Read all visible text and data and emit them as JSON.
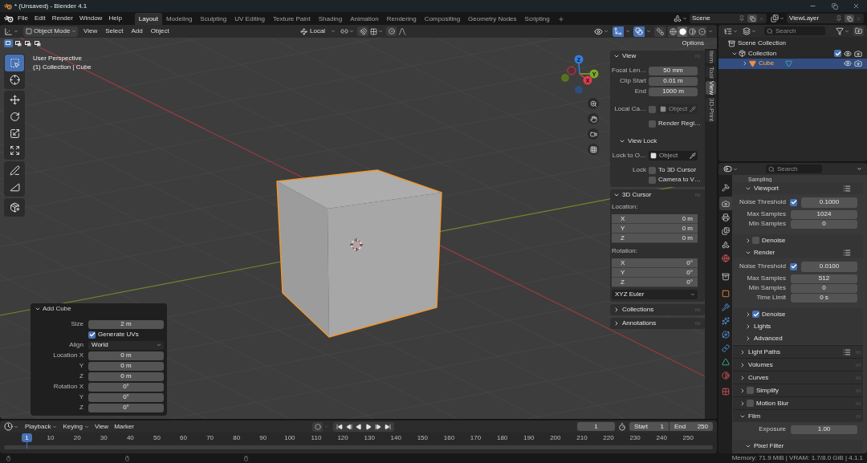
{
  "window": {
    "title": "* (Unsaved) - Blender 4.1"
  },
  "top_bar": {
    "menus": [
      "File",
      "Edit",
      "Render",
      "Window",
      "Help"
    ],
    "workspaces": [
      {
        "label": "Layout",
        "selected": true
      },
      {
        "label": "Modeling",
        "selected": false
      },
      {
        "label": "Sculpting",
        "selected": false
      },
      {
        "label": "UV Editing",
        "selected": false
      },
      {
        "label": "Texture Paint",
        "selected": false
      },
      {
        "label": "Shading",
        "selected": false
      },
      {
        "label": "Animation",
        "selected": false
      },
      {
        "label": "Rendering",
        "selected": false
      },
      {
        "label": "Compositing",
        "selected": false
      },
      {
        "label": "Geometry Nodes",
        "selected": false
      },
      {
        "label": "Scripting",
        "selected": false
      }
    ],
    "scene": "Scene",
    "view_layer": "ViewLayer"
  },
  "viewport": {
    "header": {
      "mode": "Object Mode",
      "menus": [
        "View",
        "Select",
        "Add",
        "Object"
      ],
      "orientation": "Local",
      "snap": false,
      "proportional_editing": false,
      "gizmos": true,
      "overlays": true,
      "xray": false,
      "shading": [
        {
          "selected": false
        },
        {
          "selected": true
        },
        {
          "selected": false
        },
        {
          "selected": false
        }
      ]
    },
    "select_modes": [
      {
        "selected": true
      },
      {
        "selected": false
      },
      {
        "selected": false
      },
      {
        "selected": false
      }
    ],
    "options": "Options",
    "tool_groups": [
      [
        {
          "selected": true
        },
        {
          "selected": false
        }
      ],
      [
        {
          "selected": false
        },
        {
          "selected": false
        },
        {
          "selected": false
        },
        {
          "selected": false
        }
      ],
      [
        {
          "selected": false
        },
        {
          "selected": false
        }
      ],
      [
        {
          "selected": false
        }
      ]
    ],
    "info": [
      "User Perspective",
      "(1) Collection | Cube"
    ],
    "gizmo": {
      "x": "X",
      "y": "Y",
      "z": "Z"
    },
    "add_cube": {
      "title": "Add Cube",
      "expanded": true,
      "rows": [
        {
          "kind": "number",
          "label": "Size",
          "value": "2 m"
        },
        {
          "kind": "checkbox",
          "text": "Generate UVs",
          "checked": true
        },
        {
          "kind": "dropdown",
          "label": "Align",
          "value": "World"
        },
        {
          "kind": "number",
          "label": "Location X",
          "value": "0 m"
        },
        {
          "kind": "number",
          "label": "Y",
          "value": "0 m"
        },
        {
          "kind": "number",
          "label": "Z",
          "value": "0 m"
        },
        {
          "kind": "number",
          "label": "Rotation X",
          "value": "0°"
        },
        {
          "kind": "number",
          "label": "Y",
          "value": "0°"
        },
        {
          "kind": "number",
          "label": "Z",
          "value": "0°"
        }
      ]
    },
    "sidebar": {
      "tabs": [
        {
          "label": "Item",
          "selected": false
        },
        {
          "label": "Tool",
          "selected": false
        },
        {
          "label": "View",
          "selected": true
        },
        {
          "label": "3D-Print",
          "selected": false
        }
      ],
      "panels": [
        {
          "title": "View",
          "expanded": true,
          "rows": [
            {
              "kind": "number",
              "label": "Focal Len…",
              "value": "50 mm"
            },
            {
              "kind": "number",
              "label": "Clip Start",
              "value": "0.01 m"
            },
            {
              "kind": "number",
              "label": "End",
              "value": "1000 m"
            },
            {
              "kind": "object",
              "label": "Local Ca…",
              "checked": false,
              "placeholder": "Object",
              "disabled": true
            },
            {
              "kind": "checkbox",
              "text": "Render Regi…",
              "checked": false
            },
            {
              "kind": "subpanel",
              "label": "View Lock",
              "expanded": true
            },
            {
              "kind": "object",
              "label": "Lock to O…",
              "placeholder": "Object",
              "disabled": false
            },
            {
              "kind": "checkbox",
              "label": "Lock",
              "text": "To 3D Cursor",
              "checked": false
            },
            {
              "kind": "checkbox",
              "text": "Camera to V…",
              "checked": false
            }
          ]
        },
        {
          "title": "3D Cursor",
          "expanded": true,
          "rows": [
            {
              "kind": "caption",
              "label": "Location:"
            },
            {
              "kind": "vector",
              "label": "X",
              "value": "0 m"
            },
            {
              "kind": "vector",
              "label": "Y",
              "value": "0 m"
            },
            {
              "kind": "vector",
              "label": "Z",
              "value": "0 m"
            },
            {
              "kind": "caption",
              "label": "Rotation:"
            },
            {
              "kind": "vector",
              "label": "X",
              "value": "0°"
            },
            {
              "kind": "vector",
              "label": "Y",
              "value": "0°"
            },
            {
              "kind": "vector",
              "label": "Z",
              "value": "0°"
            },
            {
              "kind": "dropdown",
              "value": "XYZ Euler"
            }
          ]
        },
        {
          "title": "Collections",
          "expanded": false
        },
        {
          "title": "Annotations",
          "expanded": false
        }
      ]
    }
  },
  "outliner": {
    "search": {
      "placeholder": "Search"
    },
    "tree": [
      {
        "label": "Scene Collection",
        "kind": "scene_collection",
        "selected": false,
        "children": [
          {
            "label": "Collection",
            "kind": "collection",
            "expanded": true,
            "selected": false,
            "checked": true,
            "children": [
              {
                "label": "Cube",
                "kind": "mesh_object",
                "expanded": false,
                "selected": true
              }
            ]
          }
        ]
      }
    ]
  },
  "properties": {
    "search": {
      "placeholder": "Search"
    },
    "tabs": [
      {
        "selected": false
      },
      {
        "selected": true
      },
      {
        "selected": false
      },
      {
        "selected": false
      },
      {
        "selected": false
      },
      {
        "selected": false
      },
      {
        "selected": false
      },
      {
        "selected": false
      },
      {
        "selected": false
      },
      {
        "selected": false
      },
      {
        "selected": false
      },
      {
        "selected": false
      },
      {
        "selected": false
      },
      {
        "selected": false
      },
      {
        "selected": false
      }
    ],
    "scrolled_header": "Sampling",
    "rows": [
      {
        "kind": "subpanel",
        "label": "Viewport",
        "expanded": true,
        "presets": true
      },
      {
        "kind": "toggle_number",
        "label": "Noise Threshold",
        "checked": true,
        "value": "0.1000"
      },
      {
        "kind": "number",
        "label": "Max Samples",
        "value": "1024"
      },
      {
        "kind": "number",
        "label": "Min Samples",
        "value": "0"
      },
      {
        "kind": "subpanel",
        "label": "Denoise",
        "expanded": false,
        "checked": false
      },
      {
        "kind": "subpanel",
        "label": "Render",
        "expanded": true,
        "presets": true
      },
      {
        "kind": "toggle_number",
        "label": "Noise Threshold",
        "checked": true,
        "value": "0.0100"
      },
      {
        "kind": "number",
        "label": "Max Samples",
        "value": "512"
      },
      {
        "kind": "number",
        "label": "Min Samples",
        "value": "0"
      },
      {
        "kind": "number",
        "label": "Time Limit",
        "value": "0 s"
      },
      {
        "kind": "subpanel",
        "label": "Denoise",
        "expanded": false,
        "checked": true
      },
      {
        "kind": "subpanel",
        "label": "Lights",
        "expanded": false
      },
      {
        "kind": "subpanel",
        "label": "Advanced",
        "expanded": false
      },
      {
        "kind": "panel",
        "label": "Light Paths",
        "expanded": false,
        "presets": true
      },
      {
        "kind": "panel",
        "label": "Volumes",
        "expanded": false
      },
      {
        "kind": "panel",
        "label": "Curves",
        "expanded": false
      },
      {
        "kind": "panel",
        "label": "Simplify",
        "expanded": false,
        "checked": false
      },
      {
        "kind": "panel",
        "label": "Motion Blur",
        "expanded": false,
        "checked": false
      },
      {
        "kind": "panel",
        "label": "Film",
        "expanded": true
      },
      {
        "kind": "number",
        "label": "Exposure",
        "value": "1.00"
      },
      {
        "kind": "subpanel",
        "label": "Pixel Filter",
        "expanded": true
      }
    ]
  },
  "timeline": {
    "menus": [
      {
        "label": "Playback",
        "kind": "dropdown"
      },
      {
        "label": "Keying",
        "kind": "dropdown"
      },
      {
        "label": "View",
        "kind": "menu"
      },
      {
        "label": "Marker",
        "kind": "menu"
      }
    ],
    "auto_keying": false,
    "current_frame": "1",
    "start": {
      "label": "Start",
      "value": "1"
    },
    "end": {
      "label": "End",
      "value": "250"
    },
    "playhead": "1",
    "ruler": [
      "10",
      "20",
      "30",
      "40",
      "50",
      "60",
      "70",
      "80",
      "90",
      "100",
      "110",
      "120",
      "130",
      "140",
      "150",
      "160",
      "170",
      "180",
      "190",
      "200",
      "210",
      "220",
      "230",
      "240",
      "250"
    ]
  },
  "status_bar": {
    "info": "Memory: 71.9 MiB | VRAM: 1.7/8.0 GiB | 4.1.1"
  }
}
